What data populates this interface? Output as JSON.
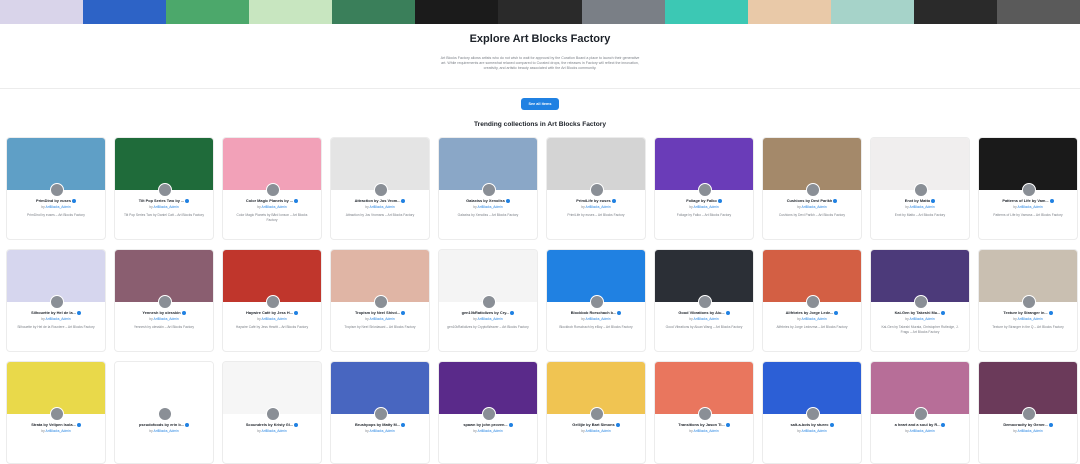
{
  "banner": {
    "tiles": [
      "#d9d4ea",
      "#2d63c6",
      "#4ca86b",
      "#c8e6c0",
      "#3a7f5a",
      "#1b1b1b",
      "#2a2a2a",
      "#7a7f86",
      "#3cc8b4",
      "#e9c9a8",
      "#a6d3c9",
      "#2a2a2a",
      "#5a5a5a"
    ]
  },
  "hero": {
    "title": "Explore Art Blocks Factory",
    "description": "Art Blocks Factory allows artists who do not wish to wait for approval by the Curation Board a place to launch their generative art. While requirements are somewhat relaxed compared to Curated drops, the releases in Factory will reflect the innovation, creativity, and artistic beauty associated with the Art Blocks community."
  },
  "actions": {
    "see_all_label": "See all items"
  },
  "section": {
    "title": "Trending collections in Art Blocks Factory"
  },
  "cards": [
    {
      "title": "PrimDind by euses",
      "by": "by",
      "author": "ArtBlocks_Admin",
      "desc": "PrimDind by euses – Art Blocks Factory",
      "img": "#5f9fc6"
    },
    {
      "title": "Tilt Pop Series Two by ...",
      "by": "by",
      "author": "ArtBlocks_Admin",
      "desc": "Tilt Pop Series Two by Daniel Catt – Art Blocks Factory",
      "img": "#1f6b3a"
    },
    {
      "title": "Color Magic Planets by ...",
      "by": "by",
      "author": "ArtBlocks_Admin",
      "desc": "Color Magic Planets by Bård Ionson – Art Blocks Factory",
      "img": "#f2a1b8"
    },
    {
      "title": "Attraction by Jos Vrom...",
      "by": "by",
      "author": "ArtBlocks_Admin",
      "desc": "Attraction by Jos Vromans – Art Blocks Factory",
      "img": "#e4e4e4"
    },
    {
      "title": "Galaxiss by Xenoliss",
      "by": "by",
      "author": "ArtBlocks_Admin",
      "desc": "Galaxiss by Xenoliss – Art Blocks Factory",
      "img": "#8aa7c7"
    },
    {
      "title": "PrimiLife by euses",
      "by": "by",
      "author": "ArtBlocks_Admin",
      "desc": "PrimiLife by euses – Art Blocks Factory",
      "img": "#d4d4d4"
    },
    {
      "title": "Foliage by Falko",
      "by": "by",
      "author": "ArtBlocks_Admin",
      "desc": "Foliage by Falko – Art Blocks Factory",
      "img": "#6a3cb8"
    },
    {
      "title": "Cushions by Devi Parikh",
      "by": "by",
      "author": "ArtBlocks_Admin",
      "desc": "Cushions by Devi Parikh – Art Blocks Factory",
      "img": "#a4896a"
    },
    {
      "title": "Enxt by Matto",
      "by": "by",
      "author": "ArtBlocks_Admin",
      "desc": "Enxt by Matto – Art Blocks Factory",
      "img": "#f0eeee"
    },
    {
      "title": "Patterns of Life by Vam...",
      "by": "by",
      "author": "ArtBlocks_Admin",
      "desc": "Patterns of Life by Vamoss – Art Blocks Factory",
      "img": "#1a1a1a"
    },
    {
      "title": "Silhouette by Hel de Ia...",
      "by": "by",
      "author": "ArtBlocks_Admin",
      "desc": "Silhouette by Hel de la Rouviere – Art Blocks Factory",
      "img": "#d6d6ee"
    },
    {
      "title": "Yennesh by olesskin",
      "by": "by",
      "author": "ArtBlocks_Admin",
      "desc": "Yennesh by olesskin – Art Blocks Factory",
      "img": "#8a5e70"
    },
    {
      "title": "Haywire Café by Jess H...",
      "by": "by",
      "author": "ArtBlocks_Admin",
      "desc": "Haywire Café by Jess Hewitt – Art Blocks Factory",
      "img": "#c0362c"
    },
    {
      "title": "Tropism by Neel Shivd...",
      "by": "by",
      "author": "ArtBlocks_Admin",
      "desc": "Tropism by Neel Shivdasani – Art Blocks Factory",
      "img": "#e0b5a5"
    },
    {
      "title": "gen10kRatiolizes by Cry...",
      "by": "by",
      "author": "ArtBlocks_Admin",
      "desc": "gen10kRatiolizes by CryptoWeaver – Art Blocks Factory",
      "img": "#f4f4f4"
    },
    {
      "title": "Blockbob Rorschach b...",
      "by": "by",
      "author": "ArtBlocks_Admin",
      "desc": "Blockbob Rorschach by eBoy – Art Blocks Factory",
      "img": "#2081e2"
    },
    {
      "title": "Good Vibrations by Aiu...",
      "by": "by",
      "author": "ArtBlocks_Admin",
      "desc": "Good Vibrations by Aluan Wang – Art Blocks Factory",
      "img": "#2b2f36"
    },
    {
      "title": "Alifrbries by Jorge Lede...",
      "by": "by",
      "author": "ArtBlocks_Admin",
      "desc": "Alifrbries by Jorge Ledezma – Art Blocks Factory",
      "img": "#d35f44"
    },
    {
      "title": "Kai-Gen by Takeshi Mu...",
      "by": "by",
      "author": "ArtBlocks_Admin",
      "desc": "Kai-Gen by Takeshi Murata, Christopher Rutledge, J. Fragu – Art Blocks Factory",
      "img": "#4c3a7a"
    },
    {
      "title": "Texture by Stranger in...",
      "by": "by",
      "author": "ArtBlocks_Admin",
      "desc": "Texture by Stranger in the Q – Art Blocks Factory",
      "img": "#c9bfb1"
    },
    {
      "title": "Strata by Velipen Isola...",
      "by": "by",
      "author": "ArtBlocks_Admin",
      "desc": "",
      "img": "#e9d94a"
    },
    {
      "title": "pseudofoods by erin b...",
      "by": "by",
      "author": "ArtBlocks_Admin",
      "desc": "",
      "img": "#ffffff"
    },
    {
      "title": "Scoundrels by Kristy Gl...",
      "by": "by",
      "author": "ArtBlocks_Admin",
      "desc": "",
      "img": "#f6f6f6"
    },
    {
      "title": "Brushpops by Matty M...",
      "by": "by",
      "author": "ArtBlocks_Admin",
      "desc": "",
      "img": "#4866c0"
    },
    {
      "title": "spawn by john proven...",
      "by": "by",
      "author": "ArtBlocks_Admin",
      "desc": "",
      "img": "#5a2a8a"
    },
    {
      "title": "Gellijie by Bart Simons",
      "by": "by",
      "author": "ArtBlocks_Admin",
      "desc": "",
      "img": "#f0c452"
    },
    {
      "title": "Transitions by Jason Ti...",
      "by": "by",
      "author": "ArtBlocks_Admin",
      "desc": "",
      "img": "#e9765e"
    },
    {
      "title": "salt-a-bots by sturec",
      "by": "by",
      "author": "ArtBlocks_Admin",
      "desc": "",
      "img": "#2c5fd6"
    },
    {
      "title": "a heart and a soul by R...",
      "by": "by",
      "author": "ArtBlocks_Admin",
      "desc": "",
      "img": "#b76e98"
    },
    {
      "title": "Democracity by Gener...",
      "by": "by",
      "author": "ArtBlocks_Admin",
      "desc": "",
      "img": "#6b3a5a"
    }
  ]
}
